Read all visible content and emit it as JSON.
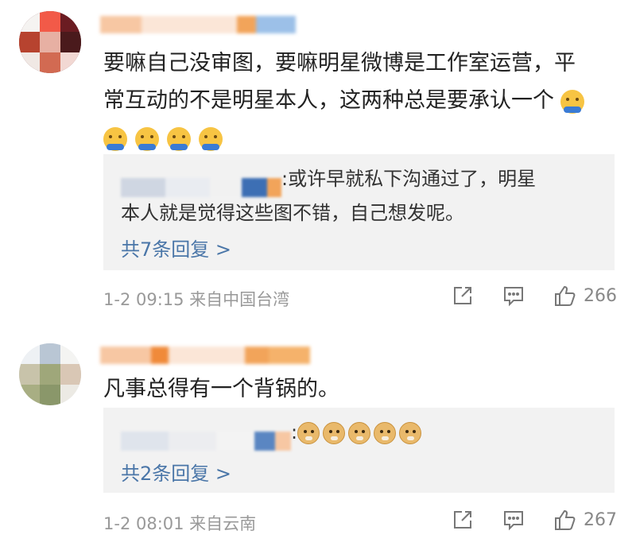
{
  "comments": [
    {
      "text_line1": "要嘛自己没审图，要嘛明星微博是工作室运营，平",
      "text_line2": "常互动的不是明星本人，这两种总是要承认一个",
      "reply_text_line1": ":或许早就私下沟通过了，明星",
      "reply_text_line2": "本人就是觉得这些图不错，自己想发呢。",
      "more_replies": "共7条回复 >",
      "meta": "1-2 09:15 来自中国台湾",
      "like_count": "266"
    },
    {
      "text_line1": "凡事总得有一个背锅的。",
      "reply_text_line1": ":",
      "more_replies": "共2条回复 >",
      "meta": "1-2 08:01 来自云南",
      "like_count": "267"
    }
  ],
  "icons": [
    "share-icon",
    "comment-icon",
    "like-icon",
    "shrug-emoji",
    "doge-emoji"
  ],
  "colors": {
    "link": "#4a76a8",
    "meta": "#999999",
    "reply_bg": "#f2f2f2",
    "username": "#f08a3a"
  }
}
